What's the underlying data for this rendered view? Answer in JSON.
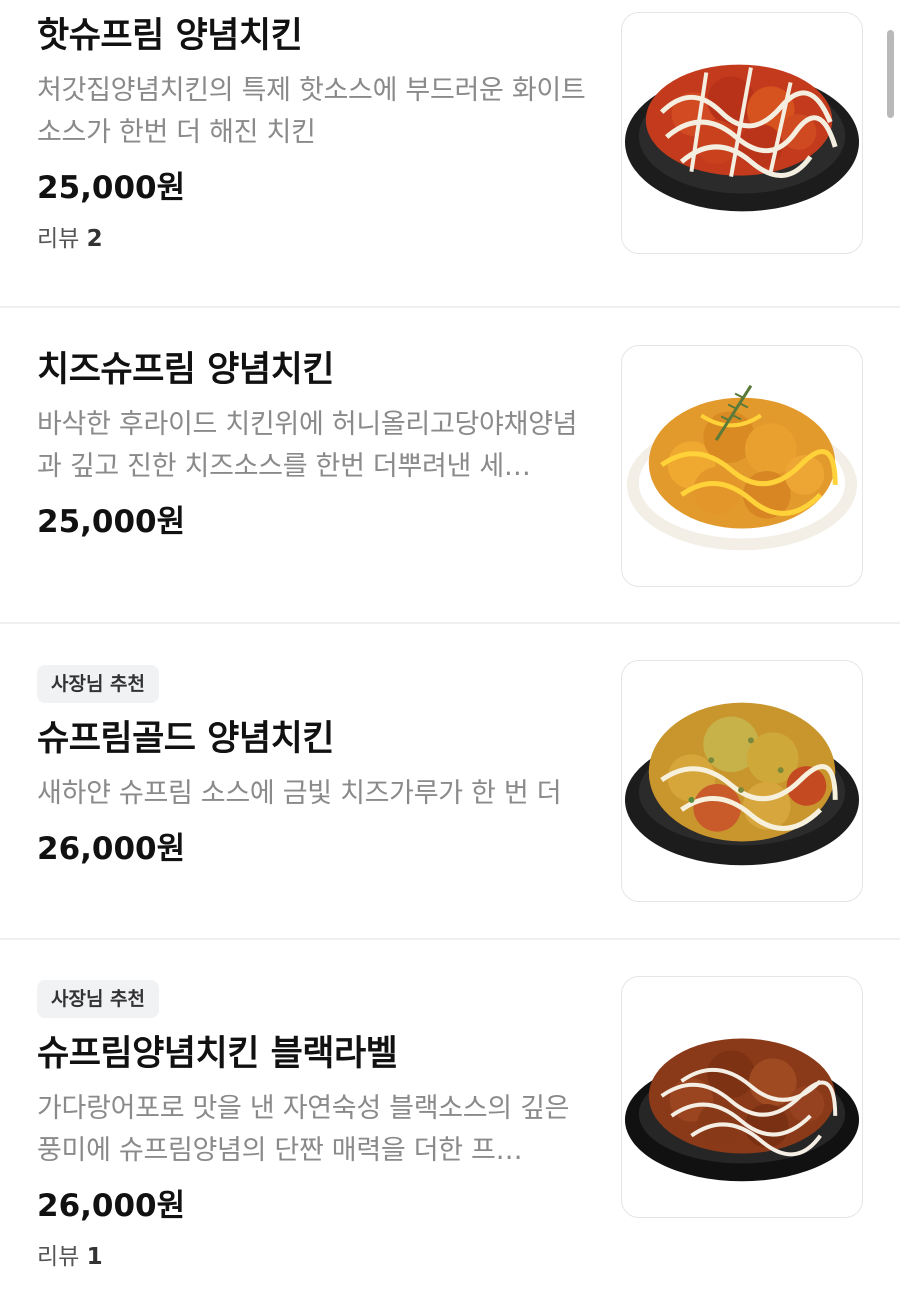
{
  "menu": {
    "items": [
      {
        "name": "핫슈프림 양념치킨",
        "description": "처갓집양념치킨의 특제 핫소스에 부드러운 화이트소스가 한번 더 해진 치킨",
        "price": "25,000원",
        "review_label": "리뷰",
        "review_count": "2"
      },
      {
        "name": "치즈슈프림 양념치킨",
        "description": "바삭한 후라이드 치킨위에 허니올리고당야채양념과 깊고 진한 치즈소스를 한번 더뿌려낸 세…",
        "price": "25,000원"
      },
      {
        "badge": "사장님 추천",
        "name": "슈프림골드 양념치킨",
        "description": "새하얀 슈프림 소스에 금빛 치즈가루가 한 번 더",
        "price": "26,000원"
      },
      {
        "badge": "사장님 추천",
        "name": "슈프림양념치킨 블랙라벨",
        "description": "가다랑어포로 맛을 낸 자연숙성 블랙소스의 깊은 풍미에 슈프림양념의 단짠 매력을 더한 프…",
        "price": "26,000원",
        "review_label": "리뷰",
        "review_count": "1"
      }
    ]
  }
}
